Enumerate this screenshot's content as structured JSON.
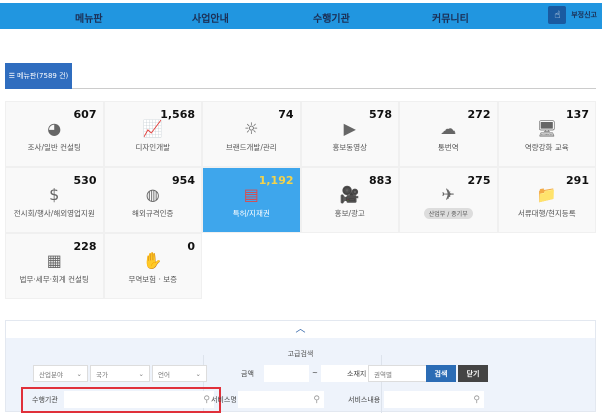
{
  "nav": {
    "items": [
      "메뉴판",
      "사업안내",
      "수행기관",
      "커뮤니티"
    ],
    "report": "부정신고"
  },
  "tab": {
    "label": "메뉴판(7589 건)"
  },
  "categories": [
    {
      "label": "조사/일반 컨설팅",
      "count": "607",
      "icon": "pie-chart-icon"
    },
    {
      "label": "디자인개발",
      "count": "1,568",
      "icon": "design-chart-icon"
    },
    {
      "label": "브랜드개발/관리",
      "count": "74",
      "icon": "idea-head-icon"
    },
    {
      "label": "홍보동영상",
      "count": "578",
      "icon": "video-laptop-icon"
    },
    {
      "label": "통번역",
      "count": "272",
      "icon": "translation-icon"
    },
    {
      "label": "역량강화 교육",
      "count": "137",
      "icon": "monitor-icon"
    },
    {
      "label": "전시회/행사/해외영업지원",
      "count": "530",
      "icon": "laptop-dollar-icon"
    },
    {
      "label": "해외규격인증",
      "count": "954",
      "icon": "globe-cert-icon"
    },
    {
      "label": "특허/지재권",
      "count": "1,192",
      "icon": "patent-icon",
      "active": true
    },
    {
      "label": "홍보/광고",
      "count": "883",
      "icon": "camera-icon"
    },
    {
      "label": "산업부 / 중기부",
      "count": "275",
      "icon": "plane-globe-icon",
      "pill": true
    },
    {
      "label": "서류대행/현지등록",
      "count": "291",
      "icon": "folder-icon"
    },
    {
      "label": "법무·세무·회계 컨설팅",
      "count": "228",
      "icon": "calculator-icon"
    },
    {
      "label": "무역보험 · 보증",
      "count": "0",
      "icon": "money-hands-icon"
    }
  ],
  "search": {
    "title": "고급검색",
    "industry": "산업분야",
    "country": "국가",
    "language": "언어",
    "amount_label": "금액",
    "amount_sep": "~",
    "location_label": "소재지",
    "location_value": "권역별",
    "search_btn": "검색",
    "close_btn": "닫기",
    "org_label": "수행기관",
    "service_name_label": "서비스명",
    "service_content_label": "서비스내용"
  },
  "colors": {
    "nav": "#2196e0",
    "accent": "#2f6dbf",
    "active": "#3ea6ec",
    "highlight": "#e0303a"
  }
}
